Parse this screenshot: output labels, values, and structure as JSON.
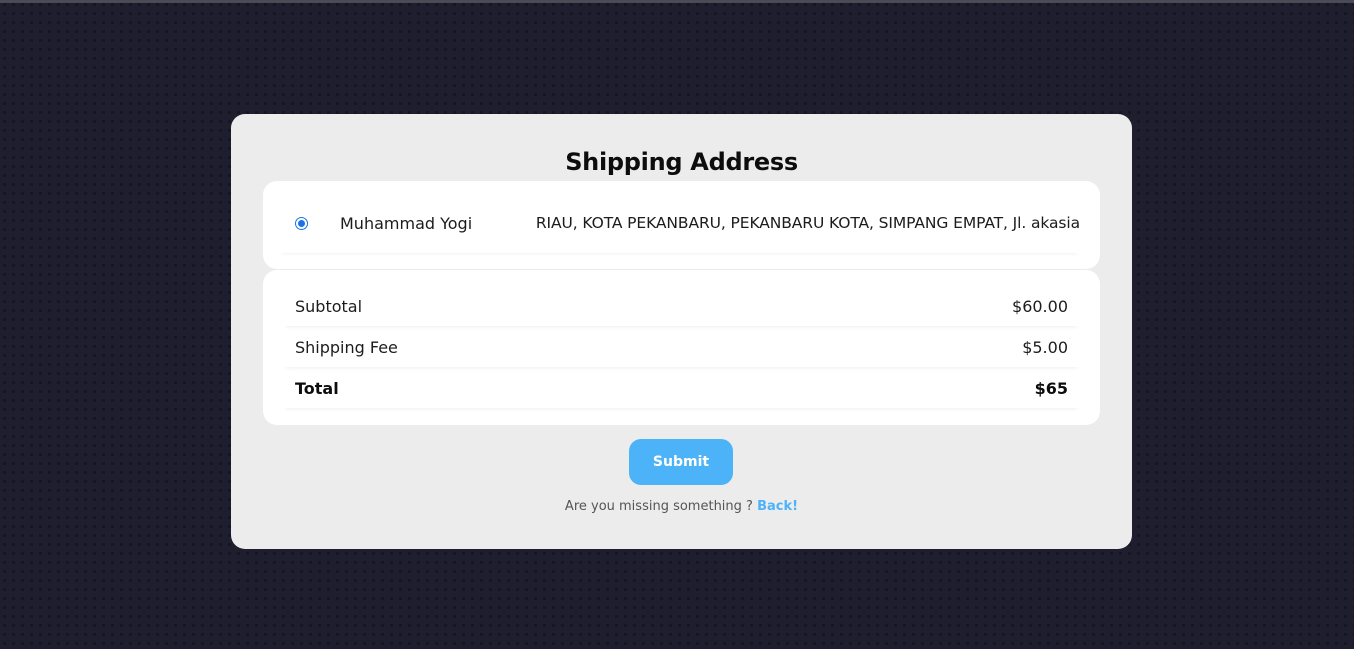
{
  "page": {
    "title": "Shipping Address"
  },
  "address": {
    "selected": true,
    "name": "Muhammad Yogi",
    "detail": "RIAU, KOTA PEKANBARU, PEKANBARU KOTA, SIMPANG EMPAT, Jl. akasia"
  },
  "summary": {
    "subtotal_label": "Subtotal",
    "subtotal_value": "$60.00",
    "shipping_label": "Shipping Fee",
    "shipping_value": "$5.00",
    "total_label": "Total",
    "total_value": "$65"
  },
  "actions": {
    "submit_label": "Submit",
    "missing_text": "Are you missing something ?",
    "back_link": "Back!"
  },
  "colors": {
    "background": "#1e1e2f",
    "card": "#ececec",
    "accent": "#4db3f9",
    "radio": "#1a73e8"
  }
}
